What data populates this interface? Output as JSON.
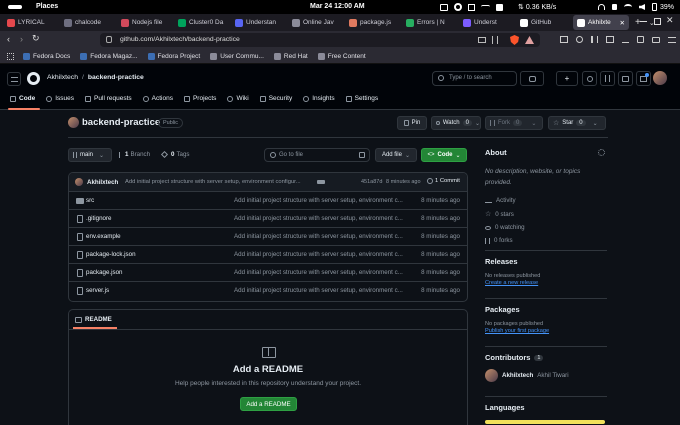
{
  "system_bar": {
    "places": "Places",
    "clock": "Mar 24  12:00 AM",
    "net_speed": "0.36 KB/s",
    "battery": "39%"
  },
  "browser_tabs": [
    {
      "label": "LYRICAL",
      "color": "#e5484d"
    },
    {
      "label": "chalcode",
      "color": "#6e6e80"
    },
    {
      "label": "Nodejs file",
      "color": "#d1495b"
    },
    {
      "label": "Cluster0 Da",
      "color": "#00a35c"
    },
    {
      "label": "Understan",
      "color": "#5865f2"
    },
    {
      "label": "Online Jav",
      "color": "#8b8b99"
    },
    {
      "label": "package.js",
      "color": "#e07a5f"
    },
    {
      "label": "Errors | N",
      "color": "#27ae60"
    },
    {
      "label": "Underst",
      "color": "#7c5cff"
    },
    {
      "label": "GitHub",
      "color": "#ffffff"
    },
    {
      "label": "Akhilxte",
      "color": "#ffffff"
    }
  ],
  "address": {
    "url": "github.com/Akhilxtech/backend-practice"
  },
  "bookmarks": [
    {
      "label": "Fedora Docs",
      "color": "#3c6eb4"
    },
    {
      "label": "Fedora Magaz...",
      "color": "#3c6eb4"
    },
    {
      "label": "Fedora Project",
      "color": "#3c6eb4"
    },
    {
      "label": "User Commu...",
      "color": "#8b8b99"
    },
    {
      "label": "Red Hat",
      "color": "#8b8b99"
    },
    {
      "label": "Free Content",
      "color": "#8b8b99"
    }
  ],
  "gh": {
    "owner": "Akhilxtech",
    "separator": "/",
    "repo": "backend-practice",
    "search_placeholder": "Type / to search",
    "nav": [
      {
        "label": "Code",
        "icon": "code-icon"
      },
      {
        "label": "Issues",
        "icon": "issues-icon"
      },
      {
        "label": "Pull requests",
        "icon": "pull-request-icon"
      },
      {
        "label": "Actions",
        "icon": "actions-icon"
      },
      {
        "label": "Projects",
        "icon": "projects-icon"
      },
      {
        "label": "Wiki",
        "icon": "wiki-icon"
      },
      {
        "label": "Security",
        "icon": "security-icon"
      },
      {
        "label": "Insights",
        "icon": "insights-icon"
      },
      {
        "label": "Settings",
        "icon": "settings-icon"
      }
    ]
  },
  "repo": {
    "name": "backend-practice",
    "visibility": "Public",
    "pin": "Pin",
    "watch": "Watch",
    "watch_count": "0",
    "fork": "Fork",
    "fork_count": "0",
    "star": "Star",
    "star_count": "0"
  },
  "filebar": {
    "branch": "main",
    "branch_count": "1",
    "branch_label": "Branch",
    "tag_count": "0",
    "tag_label": "Tags",
    "goto_placeholder": "Go to file",
    "add_file": "Add file",
    "code": "Code"
  },
  "commit": {
    "author": "Akhilxtech",
    "message": "Add initial project structure with server setup, environment configur...",
    "hash": "451a87d",
    "time": "8 minutes ago",
    "count": "1 Commit"
  },
  "files": [
    {
      "name": "src",
      "type": "dir",
      "message": "Add initial project structure with server setup, environment c...",
      "age": "8 minutes ago"
    },
    {
      "name": ".gitignore",
      "type": "file",
      "message": "Add initial project structure with server setup, environment c...",
      "age": "8 minutes ago"
    },
    {
      "name": "env.example",
      "type": "file",
      "message": "Add initial project structure with server setup, environment c...",
      "age": "8 minutes ago"
    },
    {
      "name": "package-lock.json",
      "type": "file",
      "message": "Add initial project structure with server setup, environment c...",
      "age": "8 minutes ago"
    },
    {
      "name": "package.json",
      "type": "file",
      "message": "Add initial project structure with server setup, environment c...",
      "age": "8 minutes ago"
    },
    {
      "name": "server.js",
      "type": "file",
      "message": "Add initial project structure with server setup, environment c...",
      "age": "8 minutes ago"
    }
  ],
  "readme": {
    "tab": "README",
    "title": "Add a README",
    "subtitle": "Help people interested in this repository understand your project.",
    "button": "Add a README"
  },
  "about": {
    "heading": "About",
    "description": "No description, website, or topics provided.",
    "activity": "Activity",
    "stars": "0 stars",
    "watching": "0 watching",
    "forks": "0 forks"
  },
  "releases": {
    "heading": "Releases",
    "none": "No releases published",
    "link": "Create a new release"
  },
  "packages": {
    "heading": "Packages",
    "none": "No packages published",
    "link": "Publish your first package"
  },
  "contributors": {
    "heading": "Contributors",
    "count": "1",
    "user": "Akhilxtech",
    "fullname": "Akhil Tiwari"
  },
  "languages": {
    "heading": "Languages",
    "color": "#f1e05a"
  },
  "colors": {
    "green": "#238636",
    "link": "#4493f8",
    "bg": "#0d1117",
    "border": "#30363d"
  }
}
